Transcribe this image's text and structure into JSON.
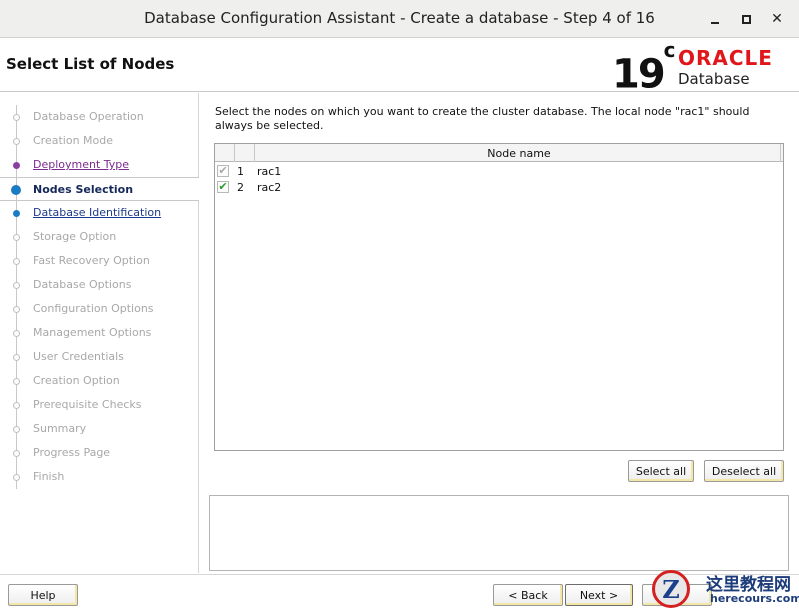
{
  "window": {
    "title": "Database Configuration Assistant - Create a database - Step 4 of 16"
  },
  "header": {
    "page_title": "Select List of Nodes",
    "logo": {
      "version": "19",
      "version_suffix": "c",
      "brand": "ORACLE",
      "product": "Database"
    }
  },
  "nav": {
    "items": [
      {
        "label": "Database Operation",
        "state": "done"
      },
      {
        "label": "Creation Mode",
        "state": "done"
      },
      {
        "label": "Deployment Type",
        "state": "visited"
      },
      {
        "label": "Nodes Selection",
        "state": "current"
      },
      {
        "label": "Database Identification",
        "state": "next"
      },
      {
        "label": "Storage Option",
        "state": "pending"
      },
      {
        "label": "Fast Recovery Option",
        "state": "pending"
      },
      {
        "label": "Database Options",
        "state": "pending"
      },
      {
        "label": "Configuration Options",
        "state": "pending"
      },
      {
        "label": "Management Options",
        "state": "pending"
      },
      {
        "label": "User Credentials",
        "state": "pending"
      },
      {
        "label": "Creation Option",
        "state": "pending"
      },
      {
        "label": "Prerequisite Checks",
        "state": "pending"
      },
      {
        "label": "Summary",
        "state": "pending"
      },
      {
        "label": "Progress Page",
        "state": "pending"
      },
      {
        "label": "Finish",
        "state": "pending"
      }
    ]
  },
  "main": {
    "instructions": "Select the nodes on which you want to create the cluster database. The local node \"rac1\" should always be selected.",
    "table": {
      "column_header": "Node name",
      "rows": [
        {
          "index": "1",
          "name": "rac1",
          "checked": true,
          "disabled": true
        },
        {
          "index": "2",
          "name": "rac2",
          "checked": true,
          "disabled": false
        }
      ]
    },
    "select_all_label": "Select all",
    "deselect_all_label": "Deselect all"
  },
  "footer": {
    "help_label": "Help",
    "back_label": "< Back",
    "next_label": "Next >"
  },
  "watermark": {
    "emblem_letter": "Z",
    "chinese_text": "这里教程网",
    "url": "herecours.com"
  },
  "colors": {
    "oracle_red": "#e0161a",
    "current_step_blue": "#1a7cc4",
    "visited_purple": "#7a2b8e",
    "check_green": "#2c9a2c"
  }
}
